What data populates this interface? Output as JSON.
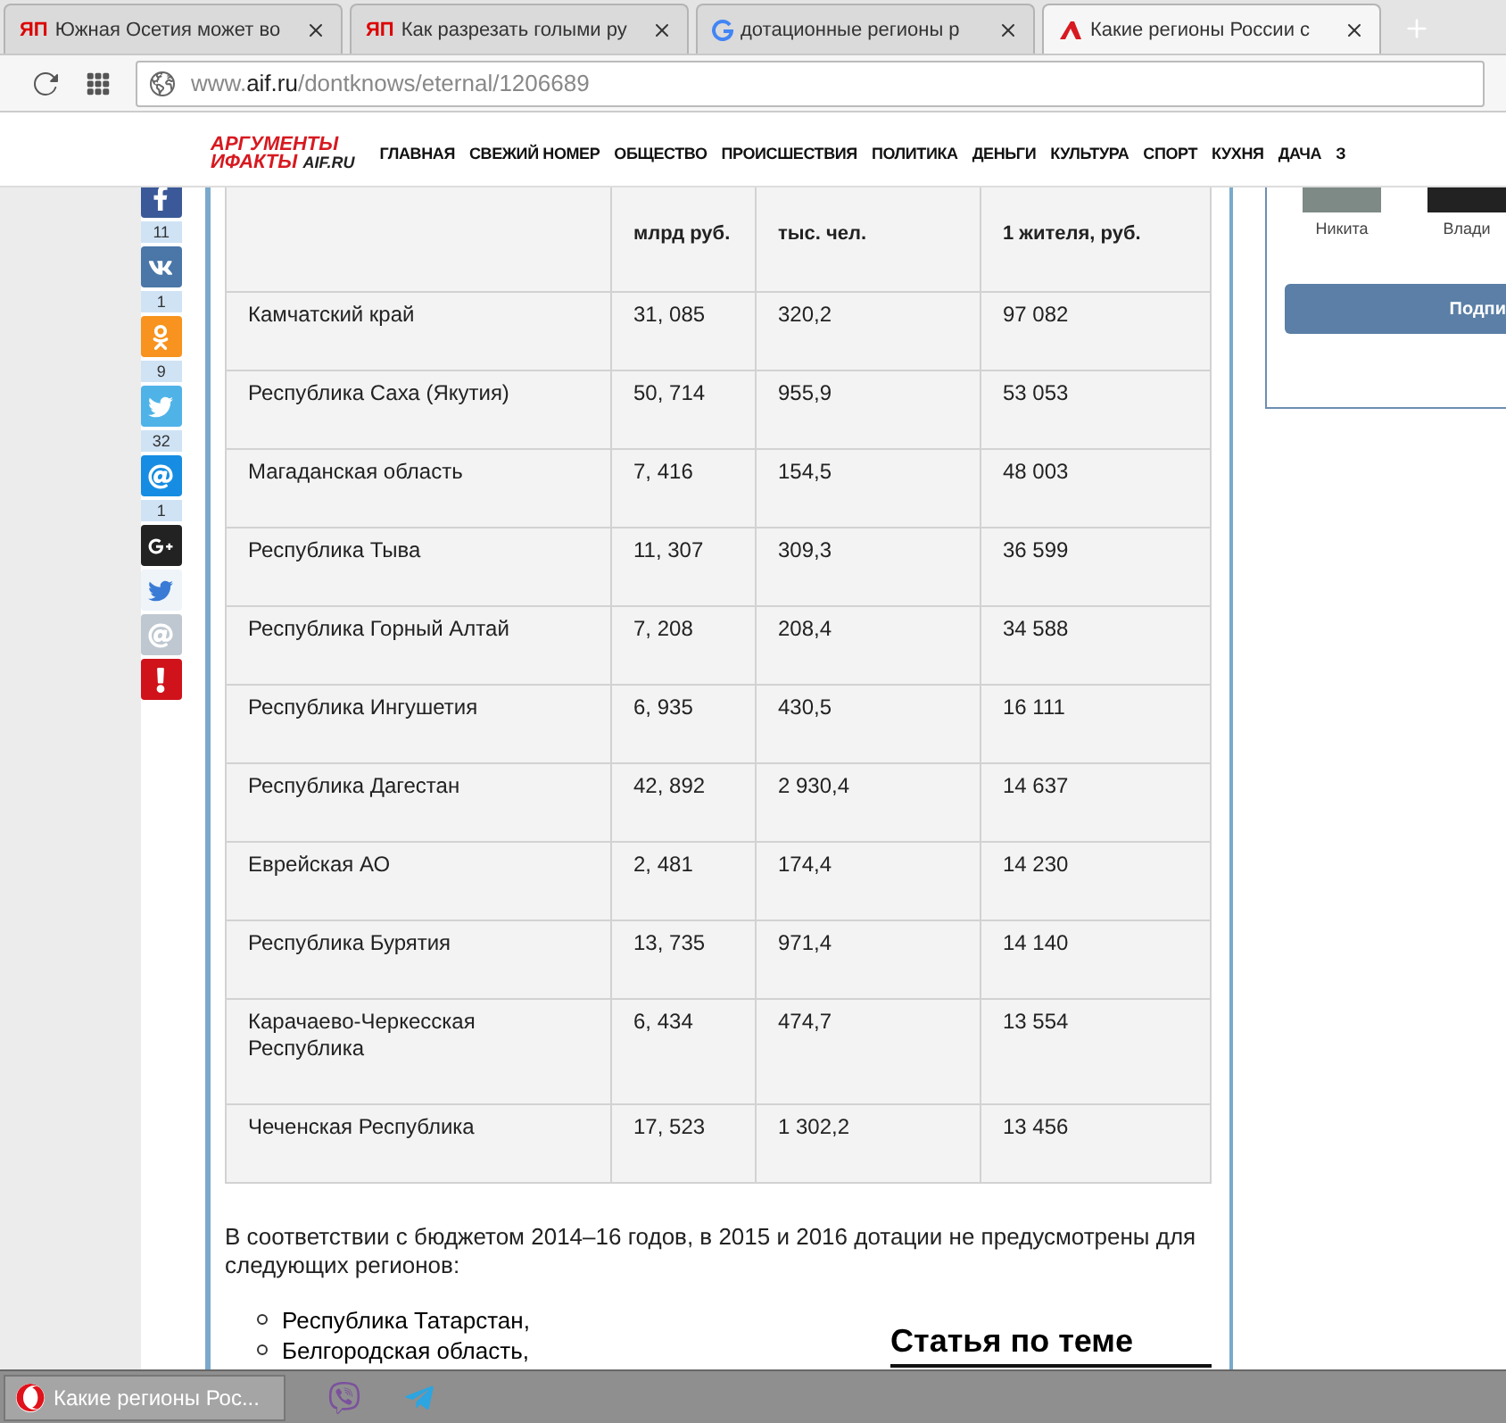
{
  "browser": {
    "tabs": [
      {
        "title": "Южная Осетия может во",
        "kind": "badge",
        "badge": "ЯП",
        "selected": false
      },
      {
        "title": "Как разрезать голыми ру",
        "kind": "badge",
        "badge": "ЯП",
        "selected": false
      },
      {
        "title": "дотационные регионы р",
        "kind": "google",
        "selected": false
      },
      {
        "title": "Какие регионы России с",
        "kind": "logo",
        "selected": true
      }
    ],
    "url": {
      "prefix": "www.",
      "host": "aif.ru",
      "path": "/dontknows/eternal/1206689"
    }
  },
  "site": {
    "logo": {
      "line1": "АРГУМЕНТЫ",
      "line2": "ИФАКТЫ",
      "domain": "AIF.RU"
    },
    "nav": [
      "ГЛАВНАЯ",
      "СВЕЖИЙ НОМЕР",
      "ОБЩЕСТВО",
      "ПРОИСШЕСТВИЯ",
      "ПОЛИТИКА",
      "ДЕНЬГИ",
      "КУЛЬТУРА",
      "СПОРТ",
      "КУХНЯ",
      "ДАЧА",
      "З"
    ]
  },
  "share": [
    {
      "kind": "facebook",
      "count": "11"
    },
    {
      "kind": "vk",
      "count": "1"
    },
    {
      "kind": "ok",
      "count": "9"
    },
    {
      "kind": "twitter",
      "count": "32"
    },
    {
      "kind": "mail",
      "count": "1"
    },
    {
      "kind": "gplus"
    },
    {
      "kind": "bird"
    },
    {
      "kind": "pen"
    },
    {
      "kind": "alert"
    }
  ],
  "table": {
    "columns": [
      "",
      "млрд  руб.",
      "тыс. чел.",
      "1 жителя, руб."
    ],
    "rows": [
      [
        "Камчатский край",
        "31, 085",
        "320,2",
        "97 082"
      ],
      [
        "Республика Саха (Якутия)",
        "50, 714",
        "955,9",
        "53 053"
      ],
      [
        "Магаданская область",
        "7, 416",
        "154,5",
        "48 003"
      ],
      [
        "Республика Тыва",
        "11, 307",
        "309,3",
        "36 599"
      ],
      [
        "Республика Горный Алтай",
        "7, 208",
        "208,4",
        "34 588"
      ],
      [
        "Республика Ингушетия",
        "6, 935",
        "430,5",
        "16 111"
      ],
      [
        "Республика Дагестан",
        "42, 892",
        "2 930,4",
        "14 637"
      ],
      [
        "Еврейская АО",
        "2, 481",
        "174,4",
        "14 230"
      ],
      [
        "Республика Бурятия",
        "13, 735",
        "971,4",
        "14 140"
      ],
      [
        "Карачаево-Черкесская Республика",
        "6, 434",
        "474,7",
        "13 554"
      ],
      [
        "Чеченская Республика",
        "17, 523",
        "1 302,2",
        "13 456"
      ]
    ]
  },
  "paragraph": "В соответствии с бюджетом 2014–16 годов, в 2015 и 2016 дотации не предусмотрены для следующих регионов:",
  "list": [
    "Республика Татарстан,",
    "Белгородская область,"
  ],
  "related": {
    "title": "Статья по теме"
  },
  "widget": {
    "members": [
      "Никита",
      "Влади"
    ],
    "button": "Подпи"
  },
  "taskbar": {
    "window": "Какие регионы Рос...",
    "apps": [
      {
        "kind": "viber"
      },
      {
        "kind": "telegram"
      }
    ]
  }
}
